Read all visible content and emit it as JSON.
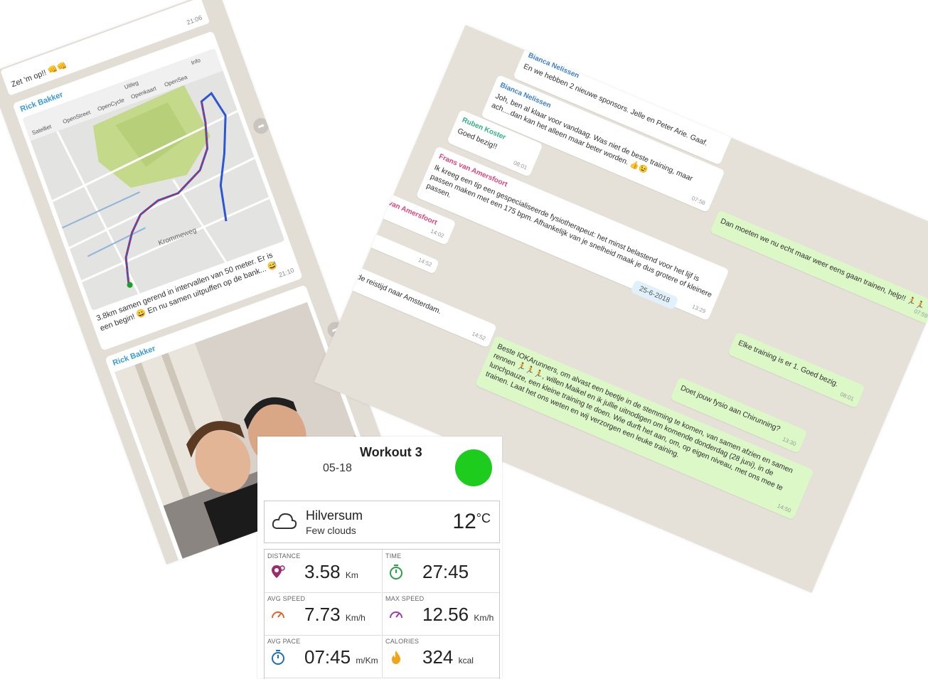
{
  "workout": {
    "title": "Workout 3",
    "date": "05-18",
    "weather": {
      "city": "Hilversum",
      "description": "Few clouds",
      "temperature": "12",
      "temp_unit": "°C"
    },
    "stats": [
      {
        "label": "DISTANCE",
        "value": "3.58",
        "unit": "Km",
        "icon": "location-pin-icon",
        "color": "#9c2a6e"
      },
      {
        "label": "TIME",
        "value": "27:45",
        "unit": "",
        "icon": "stopwatch-icon",
        "color": "#2e9e48"
      },
      {
        "label": "AVG SPEED",
        "value": "7.73",
        "unit": "Km/h",
        "icon": "speedometer-icon",
        "color": "#e0642a"
      },
      {
        "label": "MAX SPEED",
        "value": "12.56",
        "unit": "Km/h",
        "icon": "speedometer-icon",
        "color": "#a23aa8"
      },
      {
        "label": "AVG PACE",
        "value": "07:45",
        "unit": "m/Km",
        "icon": "stopwatch-icon",
        "color": "#1e6fb8"
      },
      {
        "label": "CALORIES",
        "value": "324",
        "unit": "kcal",
        "icon": "flame-icon",
        "color": "#f2a417"
      }
    ]
  },
  "left_chat": {
    "top_message": {
      "text": "Zet 'm op!! 👊👊",
      "time": "21:06"
    },
    "map_message": {
      "sender": "Rick Bakker",
      "map_labels": {
        "tab1": "Satelliet",
        "tab2": "OpenStreet",
        "tab3": "OpenCycle",
        "tab4": "Openkaart",
        "tab5": "OpenSea",
        "tab6": "Opentopo",
        "uitleg": "Uitleg",
        "info": "Info",
        "street": "Krommeweg"
      },
      "caption": "3.8km samen gerend in intervallen van 50 meter. Er is een begin! 😀 En nu samen uitpuffen op de bank... 😅",
      "time": "21:10"
    },
    "photo_message": {
      "sender": "Rick Bakker"
    }
  },
  "right_chat": {
    "messages": [
      {
        "sender": "Bianca Nelissen",
        "sender_color": "#3d7fd1",
        "text": "En we hebben 2 nieuwe sponsors. Jelle en Peter Arie. Gaaf.",
        "time": ""
      },
      {
        "sender": "Bianca Nelissen",
        "sender_color": "#3d7fd1",
        "text": "Joh, ben al klaar voor vandaag. Was niet de beste training, maar ach....dan kan het alleen maar beter worden. 👍😉",
        "time": "07:58"
      },
      {
        "sender": "Ruben Koster",
        "sender_color": "#2eb280",
        "text": "Goed bezig!!",
        "time": "08:01"
      },
      {
        "sender": "Frans van Amersfoort",
        "sender_color": "#e0457a",
        "text": "Ik kreeg een tip een gespecialiseerde fysiotherapeut: het minst belastend voor het lijf is passen maken met een 175 bpm. Afhankelijk van je snelheid maak je dus grotere of kleinere passen.",
        "time": "13:29"
      },
      {
        "sender": "van Amersfoort",
        "sender_color": "#e0457a",
        "text": "",
        "time": "14:02"
      },
      {
        "sender": "",
        "sender_color": "#333333",
        "text": "",
        "time": "14:52"
      },
      {
        "sender": "",
        "sender_color": "#333333",
        "text": "de reistijd naar Amsterdam.",
        "time": "14:52"
      }
    ],
    "outgoing": [
      {
        "text": "Dan moeten we nu echt maar weer eens gaan trainen, help!! 🏃🏃",
        "time": "07:59"
      },
      {
        "text": "Elke training is er 1. Goed bezig.",
        "time": "08:01"
      },
      {
        "text": "Doet jouw fysio aan Chirunning?",
        "time": "13:30"
      },
      {
        "text": "Beste IOKArunners, om alvast een beetje in de stemming te komen, van samen afzien  en samen rennen 🏃🏃🏃, willen Maikel en ik jullie uitnodigen om komende donderdag (28 juni), in de lunchpauze, een kleine training te doen. Wie durft het aan, om, op eigen niveau, met ons mee te trainen. Laat het ons weten en wij verzorgen een leuke training.",
        "time": "14:50"
      }
    ],
    "date_divider": "25-6-2018"
  }
}
